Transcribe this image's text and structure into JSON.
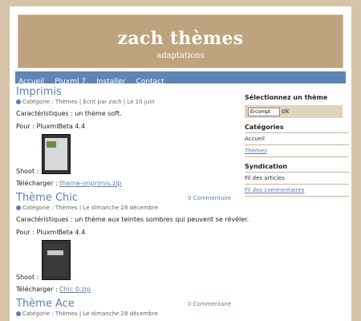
{
  "site": {
    "title": "zach thèmes",
    "subtitle": "adaptations"
  },
  "nav": [
    "Accueil",
    "Pluxml 7",
    "Installer",
    "Contact"
  ],
  "posts": [
    {
      "title": "Imprimis",
      "meta": "Catégorie : Thèmes | Écrit par zach | Le 10 juin",
      "desc": "Caractéristiques : un thème soft.",
      "pour": "Pour : PluxmlBeta 4.4",
      "shoot": "Shoot :",
      "dl_label": "Télécharger :",
      "dl_link": "theme-imprimis.zip"
    },
    {
      "title": "Thème Chic",
      "comments": "0 Commentaire",
      "meta": "Catégorie : Thèmes | Le dimanche 28 décembre",
      "desc": "Caractéristiques : un thème aux teintes sombres qui peuvent se révéler.",
      "pour": "Pour : PluxmlBeta 4.4",
      "shoot": "Shoot :",
      "dl_label": "Télécharger :",
      "dl_link": "Chic 0.zip"
    },
    {
      "title": "Thème Ace",
      "comments": "0 Commentaire",
      "meta": "Catégorie : Thèmes | Le dimanche 28 décembre"
    }
  ],
  "sidebar": {
    "select_title": "Sélectionnez un thème",
    "select_value": "Ercompt",
    "select_btn": "ok",
    "cat_title": "Catégories",
    "cat_items": [
      "Accueil",
      "Thèmes"
    ],
    "synd_title": "Syndication",
    "synd_items": [
      "Fil des articles",
      "Fil des commentaires"
    ]
  }
}
